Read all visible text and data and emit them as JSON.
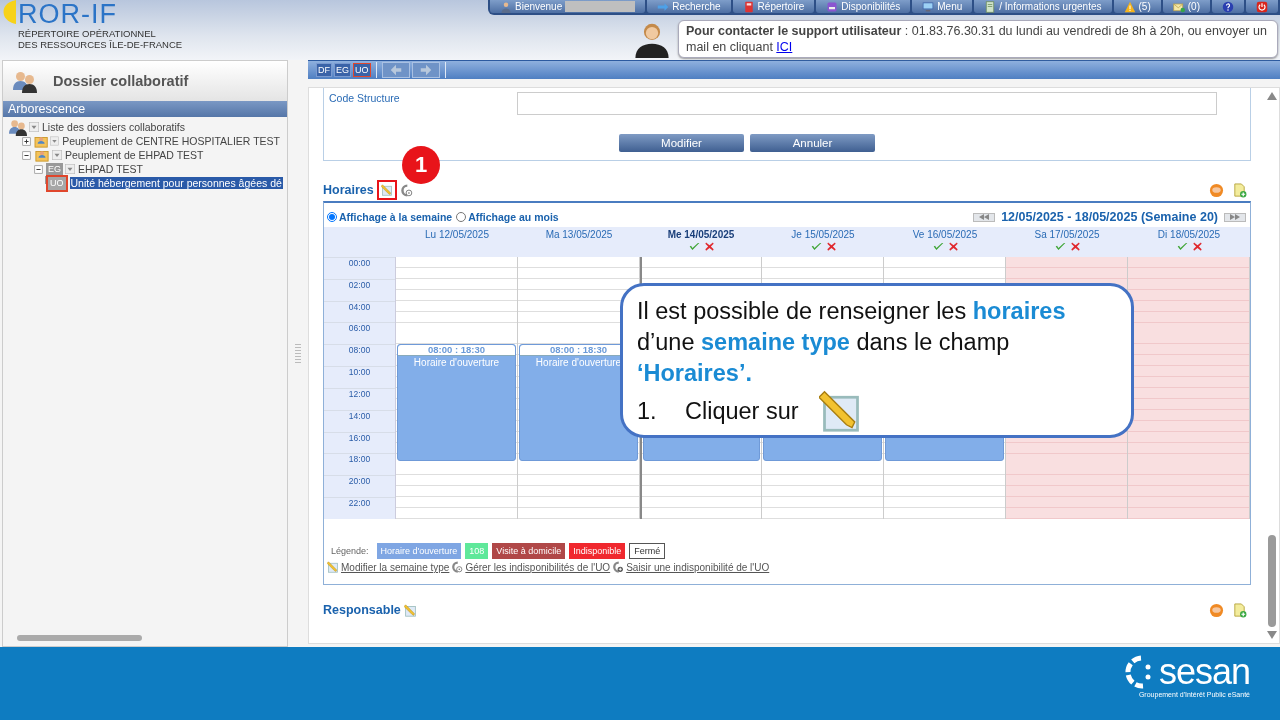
{
  "header": {
    "logo_title": "ROR-IF",
    "logo_subtitle": [
      "RÉPERTOIRE OPÉRATIONNEL",
      "DES RESSOURCES ÎLE-DE-FRANCE"
    ]
  },
  "nav": [
    {
      "kind": "user",
      "label": "Bienvenue",
      "name_hidden": true
    },
    {
      "kind": "search",
      "label": "Recherche"
    },
    {
      "kind": "book",
      "label": "Répertoire"
    },
    {
      "kind": "bed",
      "label": "Disponibilités"
    },
    {
      "kind": "monitor",
      "label": "Menu"
    },
    {
      "kind": "doc",
      "label": "/ Informations urgentes"
    },
    {
      "kind": "warning",
      "label": "(5)"
    },
    {
      "kind": "mail",
      "label": "(0)"
    },
    {
      "kind": "help"
    },
    {
      "kind": "power"
    }
  ],
  "support": {
    "text": "**Pour contacter le support utilisateur** : 01.83.76.30.31 du lundi au vendredi de 8h à 20h, ou envoyer un mail en cliquant",
    "link": "ICI"
  },
  "sidebar": {
    "title": "Dossier collaboratif",
    "section": "Arborescence",
    "tree": [
      {
        "kind": "people",
        "label": "Liste des dossiers collaboratifs",
        "children": [
          {
            "kind": "folder",
            "label": "Peuplement de CENTRE HOSPITALIER TEST",
            "expanded": false,
            "selected": false
          },
          {
            "kind": "folder",
            "label": "Peuplement de EHPAD TEST",
            "expanded": true,
            "selected": false,
            "children": [
              {
                "kind": "badge",
                "badge": "EG",
                "label": "EHPAD TEST",
                "expanded": true,
                "selected": false,
                "children": [
                  {
                    "kind": "badge",
                    "badge": "UO",
                    "label": "Unité hébergement pour personnes âgées dé",
                    "selected": true
                  }
                ]
              }
            ]
          }
        ]
      }
    ]
  },
  "toolbar": {
    "badges": [
      {
        "label": "DF",
        "selected": false
      },
      {
        "label": "EG",
        "selected": false
      },
      {
        "label": "UO",
        "selected": true
      }
    ]
  },
  "form": {
    "fields": [
      {
        "label": "Code Structure"
      }
    ],
    "buttons": [
      "Modifier",
      "Annuler"
    ]
  },
  "horaires": {
    "title": "Horaires",
    "views": [
      {
        "label": "Affichage à la semaine",
        "selected": true
      },
      {
        "label": "Affichage au mois",
        "selected": false
      }
    ],
    "range": "12/05/2025 - 18/05/2025 (Semaine 20)",
    "hours": [
      "00:00",
      "02:00",
      "04:00",
      "06:00",
      "08:00",
      "10:00",
      "12:00",
      "14:00",
      "16:00",
      "18:00",
      "20:00",
      "22:00"
    ],
    "days": [
      {
        "label": "Lu 12/05/2025",
        "today": false,
        "actions": false,
        "closed": false,
        "open": true,
        "time": "08:00 : 18:30",
        "event": "Horaire d'ouverture"
      },
      {
        "label": "Ma 13/05/2025",
        "today": false,
        "actions": false,
        "closed": false,
        "open": true,
        "time": "08:00 : 18:30",
        "event": "Horaire d'ouverture"
      },
      {
        "label": "Me 14/05/2025",
        "today": true,
        "actions": true,
        "closed": false,
        "open": true
      },
      {
        "label": "Je 15/05/2025",
        "today": false,
        "actions": true,
        "closed": false,
        "open": true
      },
      {
        "label": "Ve 16/05/2025",
        "today": false,
        "actions": true,
        "closed": false,
        "open": true
      },
      {
        "label": "Sa 17/05/2025",
        "today": false,
        "actions": true,
        "closed": true,
        "open": false
      },
      {
        "label": "Di 18/05/2025",
        "today": false,
        "actions": true,
        "closed": true,
        "open": false
      }
    ],
    "legend_label": "Légende:",
    "legend": [
      {
        "label": "Horaire d'ouverture",
        "kind": "filled",
        "color": "#7fa6e3"
      },
      {
        "label": "108",
        "kind": "filled",
        "color": "#5fe89a"
      },
      {
        "label": "Visite à domicile",
        "kind": "filled",
        "color": "#b04848"
      },
      {
        "label": "Indisponible",
        "kind": "filled",
        "color": "#f0282e"
      },
      {
        "label": "Fermé",
        "kind": "outline",
        "color": "#ffffff"
      }
    ],
    "actions": [
      {
        "kind": "edit",
        "label": "Modifier la semaine type"
      },
      {
        "kind": "manage",
        "label": "Gérer les indisponibilités de l'UO"
      },
      {
        "kind": "add",
        "label": "Saisir une indisponibilité de l'UO"
      }
    ]
  },
  "responsable": {
    "title": "Responsable"
  },
  "callout": {
    "badge": "1",
    "text": "Il est possible de renseigner les **horaires** d’une **semaine type** dans le champ **‘Horaires’.**",
    "step_number": "1.",
    "step": "Cliquer sur"
  },
  "footer": {
    "logo": "sesan",
    "tagline": "Groupement d'Intérêt Public eSanté"
  }
}
